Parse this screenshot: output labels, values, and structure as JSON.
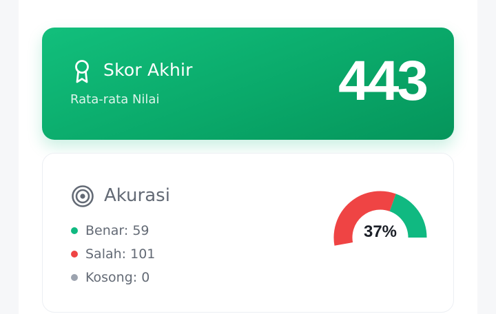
{
  "score": {
    "title": "Skor Akhir",
    "subtitle": "Rata-rata Nilai",
    "value": "443",
    "icon": "award-icon"
  },
  "accuracy": {
    "title": "Akurasi",
    "icon": "target-icon",
    "percent_label": "37%",
    "percent": 37,
    "items": [
      {
        "label": "Benar: 59",
        "color": "#10b981"
      },
      {
        "label": "Salah: 101",
        "color": "#ef4444"
      },
      {
        "label": "Kosong: 0",
        "color": "#9ca3af"
      }
    ]
  }
}
